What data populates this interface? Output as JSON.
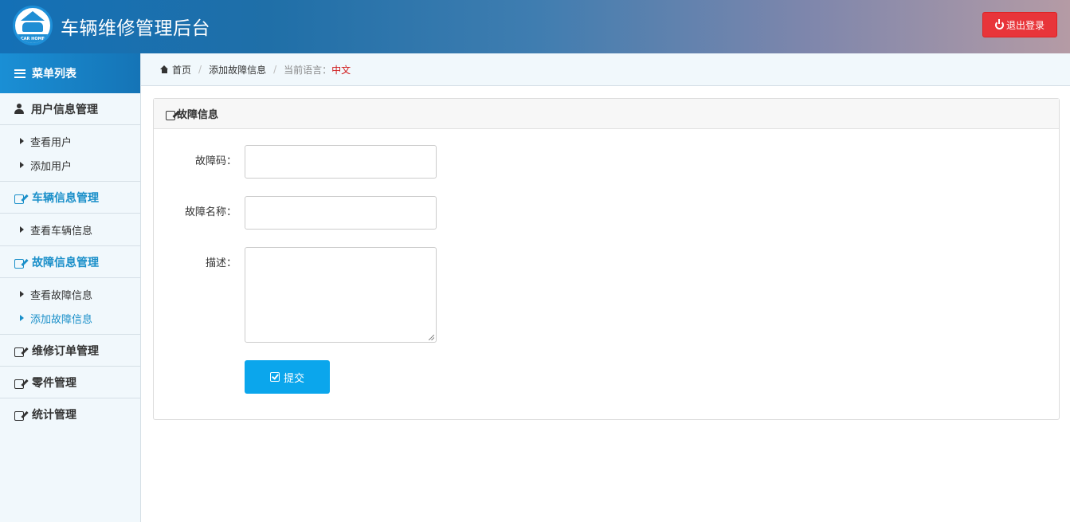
{
  "header": {
    "logo_text": "CAR HOME",
    "title": "车辆维修管理后台",
    "logout_label": "退出登录"
  },
  "sidebar": {
    "heading": "菜单列表",
    "groups": [
      {
        "label": "用户信息管理",
        "items": [
          "查看用户",
          "添加用户"
        ]
      },
      {
        "label": "车辆信息管理",
        "items": [
          "查看车辆信息"
        ]
      },
      {
        "label": "故障信息管理",
        "items": [
          "查看故障信息",
          "添加故障信息"
        ]
      },
      {
        "label": "维修订单管理",
        "items": []
      },
      {
        "label": "零件管理",
        "items": []
      },
      {
        "label": "统计管理",
        "items": []
      }
    ]
  },
  "breadcrumb": {
    "home": "首页",
    "current_page": "添加故障信息",
    "language_label": "当前语言：",
    "language_value": "中文"
  },
  "panel": {
    "title": "故障信息",
    "fields": {
      "code_label": "故障码：",
      "code_value": "",
      "name_label": "故障名称：",
      "name_value": "",
      "desc_label": "描述：",
      "desc_value": ""
    },
    "submit_label": "提交"
  },
  "colors": {
    "header_start": "#1470b6",
    "logout_bg": "#e8353a",
    "active_text": "#1a8fc9",
    "submit_bg": "#0ba6ec",
    "language_value": "#d0191a"
  }
}
